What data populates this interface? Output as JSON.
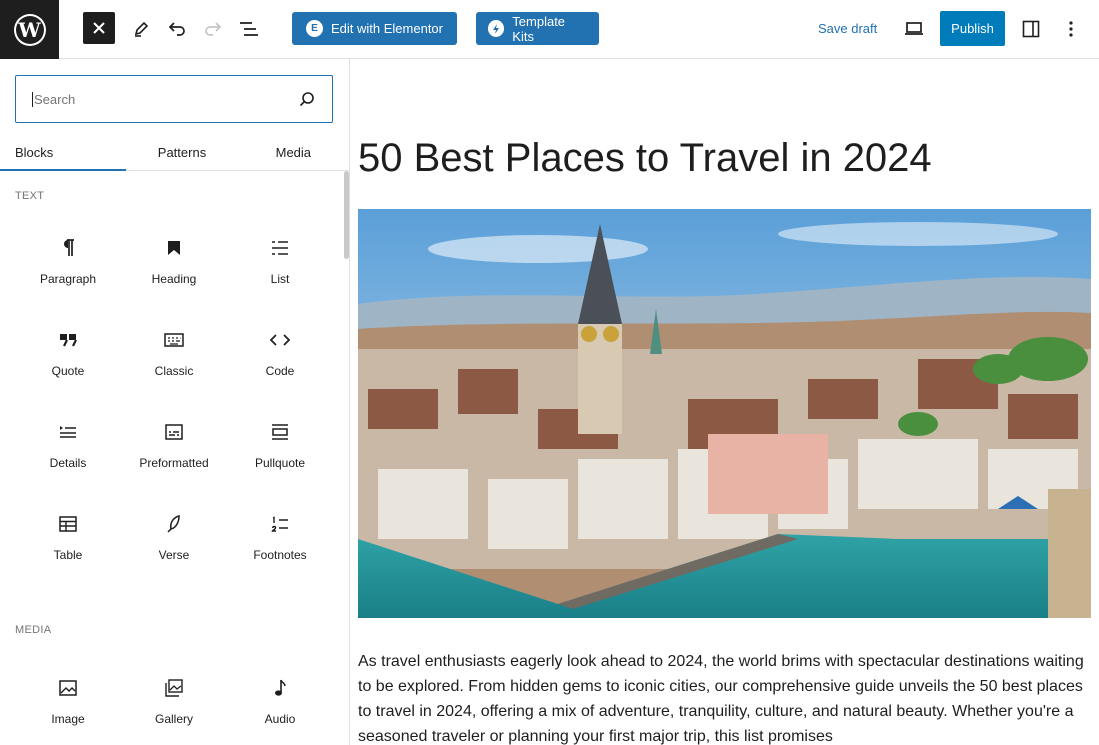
{
  "toolbar": {
    "logo_letter": "W",
    "elementor_label": "Edit with Elementor",
    "elementor_badge": "E",
    "template_kits_label": "Template Kits",
    "save_draft_label": "Save draft",
    "publish_label": "Publish"
  },
  "inserter": {
    "search_placeholder": "Search",
    "tabs": [
      {
        "label": "Blocks",
        "active": true
      },
      {
        "label": "Patterns",
        "active": false
      },
      {
        "label": "Media",
        "active": false
      }
    ],
    "categories": [
      {
        "label": "TEXT",
        "blocks": [
          {
            "label": "Paragraph",
            "icon": "paragraph-icon"
          },
          {
            "label": "Heading",
            "icon": "heading-icon"
          },
          {
            "label": "List",
            "icon": "list-icon"
          },
          {
            "label": "Quote",
            "icon": "quote-icon"
          },
          {
            "label": "Classic",
            "icon": "keyboard-icon"
          },
          {
            "label": "Code",
            "icon": "code-icon"
          },
          {
            "label": "Details",
            "icon": "details-icon"
          },
          {
            "label": "Preformatted",
            "icon": "preformatted-icon"
          },
          {
            "label": "Pullquote",
            "icon": "pullquote-icon"
          },
          {
            "label": "Table",
            "icon": "table-icon"
          },
          {
            "label": "Verse",
            "icon": "feather-icon"
          },
          {
            "label": "Footnotes",
            "icon": "footnotes-icon"
          }
        ]
      },
      {
        "label": "MEDIA",
        "blocks": [
          {
            "label": "Image",
            "icon": "image-icon"
          },
          {
            "label": "Gallery",
            "icon": "gallery-icon"
          },
          {
            "label": "Audio",
            "icon": "audio-icon"
          }
        ]
      }
    ]
  },
  "post": {
    "title": "50 Best Places to Travel in 2024",
    "body": "As travel enthusiasts eagerly look ahead to 2024, the world brims with spectacular destinations waiting to be explored. From hidden gems to iconic cities, our comprehensive guide unveils the 50 best places to travel in 2024, offering a mix of adventure, tranquility, culture, and natural beauty. Whether you're a seasoned traveler or planning your first major trip, this list promises"
  },
  "colors": {
    "accent": "#2271b1",
    "publish": "#007cba",
    "dark": "#1e1e1e"
  }
}
